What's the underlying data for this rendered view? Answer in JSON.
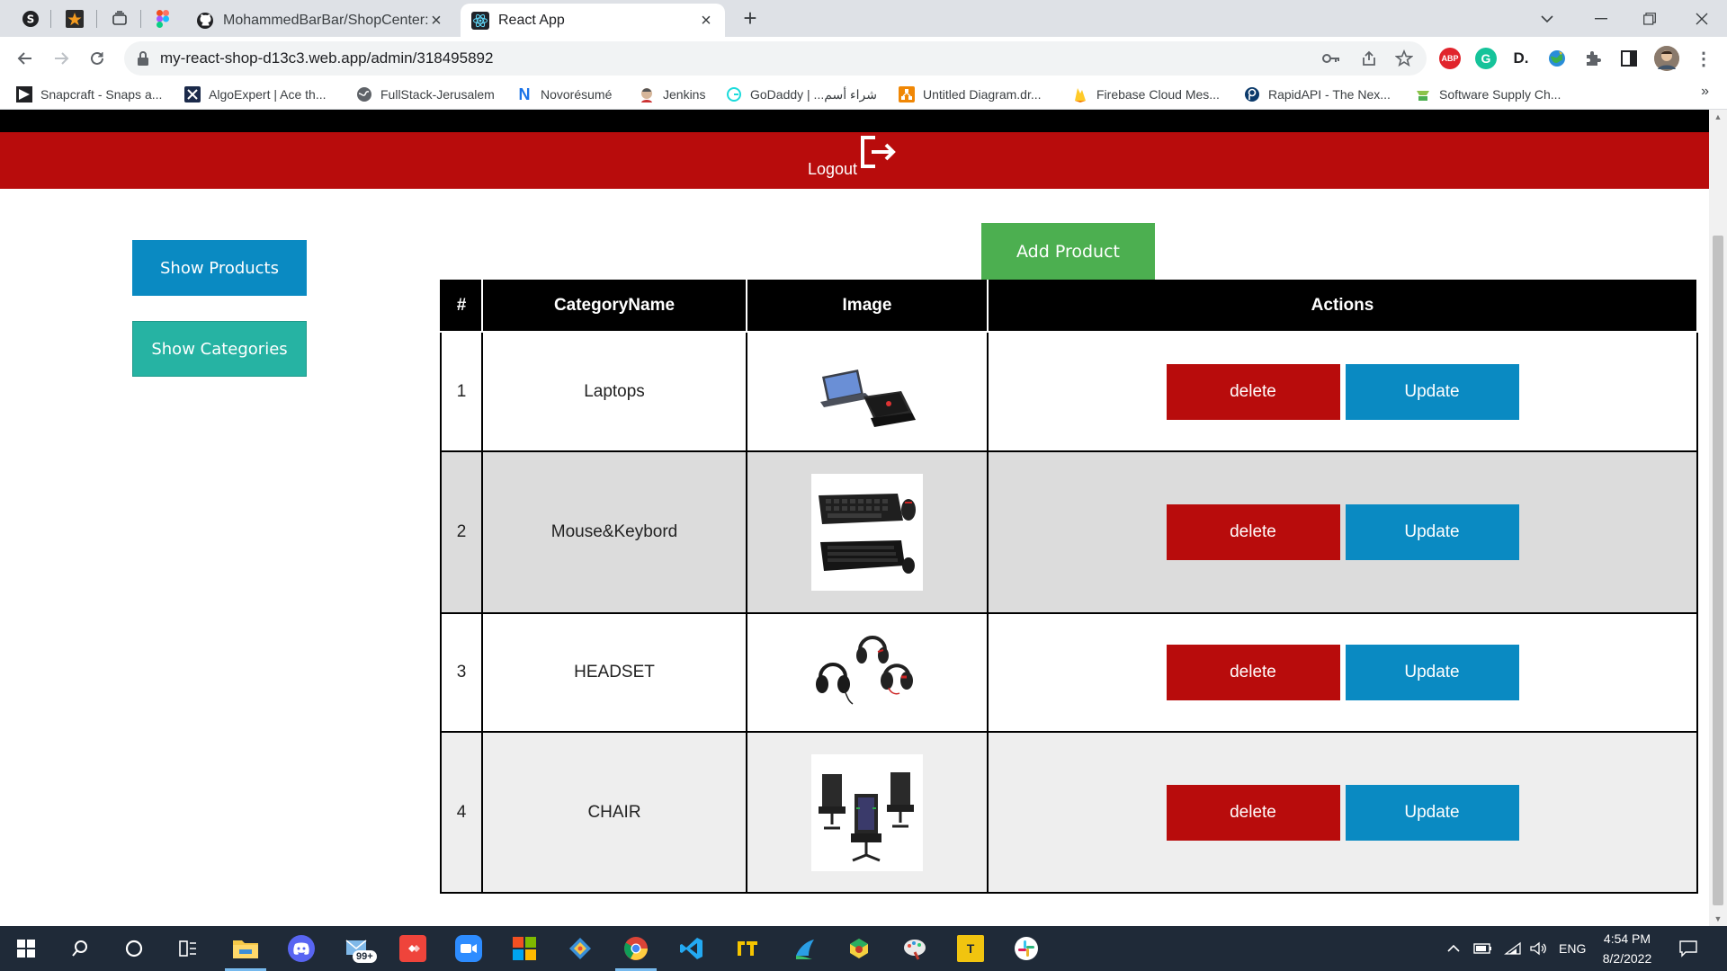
{
  "browser": {
    "tabs": [
      {
        "title": "MohammedBarBar/ShopCenter: ",
        "active": false
      },
      {
        "title": "React App",
        "active": true
      }
    ],
    "url": "my-react-shop-d13c3.web.app/admin/318495892",
    "bookmarks": [
      "Snapcraft - Snaps a...",
      "AlgoExpert | Ace th...",
      "FullStack-Jerusalem",
      "Novorésumé",
      "Jenkins",
      "GoDaddy | ...شراء أسم",
      "Untitled Diagram.dr...",
      "Firebase Cloud Mes...",
      "RapidAPI - The Nex...",
      "Software Supply Ch..."
    ],
    "extensions": {
      "abp": "ABP",
      "g": "G",
      "d": "D."
    }
  },
  "header": {
    "logout_label": "Logout"
  },
  "sidebar": {
    "show_products": "Show Products",
    "show_categories": "Show Categories"
  },
  "main": {
    "add_product": "Add Product",
    "table": {
      "headers": [
        "#",
        "CategoryName",
        "Image",
        "Actions"
      ],
      "rows": [
        {
          "num": "1",
          "name": "Laptops",
          "image": "laptops-image"
        },
        {
          "num": "2",
          "name": "Mouse&Keybord",
          "image": "keyboard-mouse-image"
        },
        {
          "num": "3",
          "name": "HEADSET",
          "image": "headsets-image"
        },
        {
          "num": "4",
          "name": "CHAIR",
          "image": "chairs-image"
        }
      ],
      "delete_label": "delete",
      "update_label": "Update"
    }
  },
  "taskbar": {
    "mail_badge": "99+",
    "language": "ENG",
    "time": "4:54 PM",
    "date": "8/2/2022"
  },
  "colors": {
    "header_red": "#b80c0c",
    "button_blue": "#0a8ac2",
    "button_teal": "#26b3a3",
    "add_green": "#4caf50"
  }
}
